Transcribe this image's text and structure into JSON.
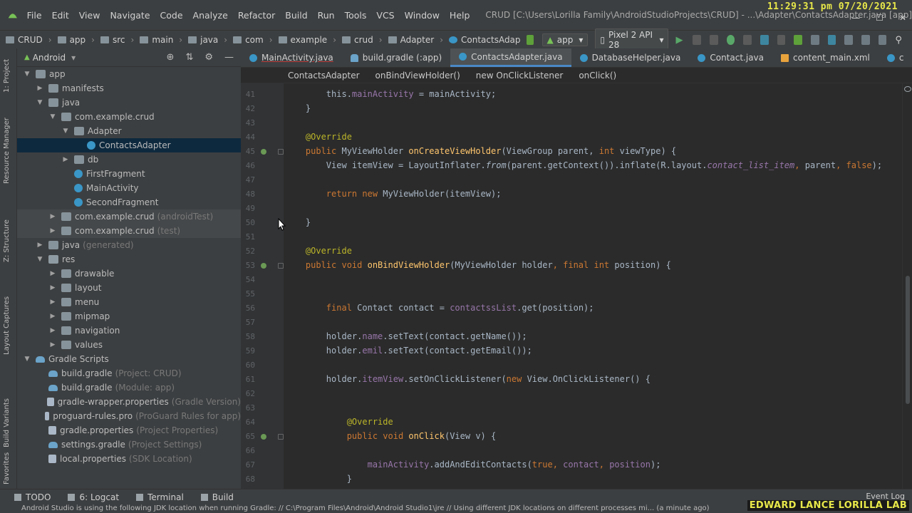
{
  "menubar": {
    "items": [
      "File",
      "Edit",
      "View",
      "Navigate",
      "Code",
      "Analyze",
      "Refactor",
      "Build",
      "Run",
      "Tools",
      "VCS",
      "Window",
      "Help"
    ],
    "title": "CRUD [C:\\Users\\Lorilla Family\\AndroidStudioProjects\\CRUD] - ...\\Adapter\\ContactsAdapter.java [app]",
    "clock": "11:29:31 pm 07/20/2021"
  },
  "navbar": {
    "crumbs": [
      "CRUD",
      "app",
      "src",
      "main",
      "java",
      "com",
      "example",
      "crud",
      "Adapter",
      "ContactsAdap"
    ],
    "run_config": "app",
    "device": "Pixel 2 API 28"
  },
  "left_strip": {
    "tabs": [
      "1: Project",
      "Resource Manager",
      "Z: Structure",
      "Layout Captures",
      "Build Variants",
      "Favorites"
    ]
  },
  "project_panel": {
    "title": "Android",
    "tree": [
      {
        "label": "app",
        "hint": "",
        "indent": 0,
        "arrow": "down",
        "icon": "folder"
      },
      {
        "label": "manifests",
        "hint": "",
        "indent": 1,
        "arrow": "right",
        "icon": "folder"
      },
      {
        "label": "java",
        "hint": "",
        "indent": 1,
        "arrow": "down",
        "icon": "folder"
      },
      {
        "label": "com.example.crud",
        "hint": "",
        "indent": 2,
        "arrow": "down",
        "icon": "pkg"
      },
      {
        "label": "Adapter",
        "hint": "",
        "indent": 3,
        "arrow": "down",
        "icon": "pkg"
      },
      {
        "label": "ContactsAdapter",
        "hint": "",
        "indent": 4,
        "arrow": "",
        "icon": "cls",
        "selected": true
      },
      {
        "label": "db",
        "hint": "",
        "indent": 3,
        "arrow": "right",
        "icon": "pkg"
      },
      {
        "label": "FirstFragment",
        "hint": "",
        "indent": 3,
        "arrow": "",
        "icon": "cls"
      },
      {
        "label": "MainActivity",
        "hint": "",
        "indent": 3,
        "arrow": "",
        "icon": "cls"
      },
      {
        "label": "SecondFragment",
        "hint": "",
        "indent": 3,
        "arrow": "",
        "icon": "cls"
      },
      {
        "label": "com.example.crud",
        "hint": "(androidTest)",
        "indent": 2,
        "arrow": "right",
        "icon": "pkg",
        "grey": true
      },
      {
        "label": "com.example.crud",
        "hint": "(test)",
        "indent": 2,
        "arrow": "right",
        "icon": "pkg",
        "grey": true
      },
      {
        "label": "java",
        "hint": "(generated)",
        "indent": 1,
        "arrow": "right",
        "icon": "folder"
      },
      {
        "label": "res",
        "hint": "",
        "indent": 1,
        "arrow": "down",
        "icon": "res"
      },
      {
        "label": "drawable",
        "hint": "",
        "indent": 2,
        "arrow": "right",
        "icon": "folder"
      },
      {
        "label": "layout",
        "hint": "",
        "indent": 2,
        "arrow": "right",
        "icon": "folder"
      },
      {
        "label": "menu",
        "hint": "",
        "indent": 2,
        "arrow": "right",
        "icon": "folder"
      },
      {
        "label": "mipmap",
        "hint": "",
        "indent": 2,
        "arrow": "right",
        "icon": "folder"
      },
      {
        "label": "navigation",
        "hint": "",
        "indent": 2,
        "arrow": "right",
        "icon": "folder"
      },
      {
        "label": "values",
        "hint": "",
        "indent": 2,
        "arrow": "right",
        "icon": "folder"
      },
      {
        "label": "Gradle Scripts",
        "hint": "",
        "indent": 0,
        "arrow": "down",
        "icon": "gradle"
      },
      {
        "label": "build.gradle",
        "hint": "(Project: CRUD)",
        "indent": 1,
        "arrow": "",
        "icon": "gradle"
      },
      {
        "label": "build.gradle",
        "hint": "(Module: app)",
        "indent": 1,
        "arrow": "",
        "icon": "gradle"
      },
      {
        "label": "gradle-wrapper.properties",
        "hint": "(Gradle Version)",
        "indent": 1,
        "arrow": "",
        "icon": "props"
      },
      {
        "label": "proguard-rules.pro",
        "hint": "(ProGuard Rules for app)",
        "indent": 1,
        "arrow": "",
        "icon": "props"
      },
      {
        "label": "gradle.properties",
        "hint": "(Project Properties)",
        "indent": 1,
        "arrow": "",
        "icon": "props"
      },
      {
        "label": "settings.gradle",
        "hint": "(Project Settings)",
        "indent": 1,
        "arrow": "",
        "icon": "gradle"
      },
      {
        "label": "local.properties",
        "hint": "(SDK Location)",
        "indent": 1,
        "arrow": "",
        "icon": "props"
      }
    ]
  },
  "editor_tabs": [
    {
      "label": "MainActivity.java",
      "icon": "cls",
      "active": false,
      "underline": true
    },
    {
      "label": "build.gradle (:app)",
      "icon": "gradle",
      "active": false
    },
    {
      "label": "ContactsAdapter.java",
      "icon": "cls",
      "active": true
    },
    {
      "label": "DatabaseHelper.java",
      "icon": "cls",
      "active": false
    },
    {
      "label": "Contact.java",
      "icon": "cls",
      "active": false
    },
    {
      "label": "content_main.xml",
      "icon": "xml",
      "active": false
    },
    {
      "label": "c",
      "icon": "cls",
      "active": false
    }
  ],
  "editor_crumbs": [
    "ContactsAdapter",
    "onBindViewHolder()",
    "new OnClickListener",
    "onClick()"
  ],
  "code": {
    "lines": [
      {
        "n": "41",
        "parts": [
          [
            "",
            "        this."
          ],
          [
            "fld",
            "mainActivity"
          ],
          [
            "",
            " = mainActivity;"
          ]
        ]
      },
      {
        "n": "42",
        "parts": [
          [
            "",
            "    }"
          ]
        ]
      },
      {
        "n": "43",
        "parts": []
      },
      {
        "n": "44",
        "parts": [
          [
            "an",
            "    @Override"
          ]
        ]
      },
      {
        "n": "45",
        "parts": [
          [
            "kw",
            "    public "
          ],
          [
            "",
            "MyViewHolder "
          ],
          [
            "fn",
            "onCreateViewHolder"
          ],
          [
            "",
            "(ViewGroup parent, "
          ],
          [
            "kw",
            "int "
          ],
          [
            "",
            "viewType) {"
          ]
        ],
        "mark": true
      },
      {
        "n": "46",
        "parts": [
          [
            "",
            "        View itemView = LayoutInflater."
          ],
          [
            "st",
            "from"
          ],
          [
            "",
            "(parent.getContext()).inflate(R.layout."
          ],
          [
            "it",
            "contact_list_item"
          ],
          [
            "kw",
            ", "
          ],
          [
            "",
            "parent"
          ],
          [
            "kw",
            ", false"
          ],
          [
            "",
            ");"
          ]
        ]
      },
      {
        "n": "47",
        "parts": []
      },
      {
        "n": "48",
        "parts": [
          [
            "kw",
            "        return new "
          ],
          [
            "",
            "MyViewHolder(itemView);"
          ]
        ]
      },
      {
        "n": "49",
        "parts": []
      },
      {
        "n": "50",
        "parts": [
          [
            "",
            "    }"
          ]
        ]
      },
      {
        "n": "51",
        "parts": []
      },
      {
        "n": "52",
        "parts": [
          [
            "an",
            "    @Override"
          ]
        ]
      },
      {
        "n": "53",
        "parts": [
          [
            "kw",
            "    public void "
          ],
          [
            "fn",
            "onBindViewHolder"
          ],
          [
            "",
            "(MyViewHolder holder"
          ],
          [
            "kw",
            ", final int "
          ],
          [
            "",
            "position) {"
          ]
        ],
        "mark": true
      },
      {
        "n": "54",
        "parts": []
      },
      {
        "n": "55",
        "parts": []
      },
      {
        "n": "56",
        "parts": [
          [
            "kw",
            "        final "
          ],
          [
            "",
            "Contact contact = "
          ],
          [
            "fld",
            "contactssList"
          ],
          [
            "",
            ".get(position);"
          ]
        ]
      },
      {
        "n": "57",
        "parts": []
      },
      {
        "n": "58",
        "parts": [
          [
            "",
            "        holder."
          ],
          [
            "fld",
            "name"
          ],
          [
            "",
            ".setText(contact.getName());"
          ]
        ]
      },
      {
        "n": "59",
        "parts": [
          [
            "",
            "        holder."
          ],
          [
            "fld",
            "emil"
          ],
          [
            "",
            ".setText(contact.getEmail());"
          ]
        ]
      },
      {
        "n": "60",
        "parts": []
      },
      {
        "n": "61",
        "parts": [
          [
            "",
            "        holder."
          ],
          [
            "fld",
            "itemView"
          ],
          [
            "",
            ".setOnClickListener("
          ],
          [
            "kw",
            "new "
          ],
          [
            "",
            "View.OnClickListener() {"
          ]
        ]
      },
      {
        "n": "62",
        "parts": []
      },
      {
        "n": "63",
        "parts": []
      },
      {
        "n": "64",
        "parts": [
          [
            "an",
            "            @Override"
          ]
        ]
      },
      {
        "n": "65",
        "parts": [
          [
            "kw",
            "            public void "
          ],
          [
            "fn",
            "onClick"
          ],
          [
            "",
            "(View v) {"
          ]
        ],
        "mark": true
      },
      {
        "n": "66",
        "parts": []
      },
      {
        "n": "67",
        "parts": [
          [
            "fld",
            "                mainActivity"
          ],
          [
            "",
            ".addAndEditContacts("
          ],
          [
            "kw",
            "true"
          ],
          [
            "kw",
            ", "
          ],
          [
            "fld",
            "contact"
          ],
          [
            "kw",
            ", "
          ],
          [
            "fld",
            "position"
          ],
          [
            "",
            ");"
          ]
        ]
      },
      {
        "n": "68",
        "parts": [
          [
            "",
            "            }"
          ]
        ]
      }
    ]
  },
  "bottom_tools": [
    "TODO",
    "6: Logcat",
    "Terminal",
    "Build"
  ],
  "event_log": "Event Log",
  "status_text": "Android Studio is using the following JDK location when running Gradle: // C:\\Program Files\\Android\\Android Studio1\\jre // Using different JDK locations on different processes mi... (a minute ago)",
  "watermark": "EDWARD LANCE LORILLA LAB"
}
